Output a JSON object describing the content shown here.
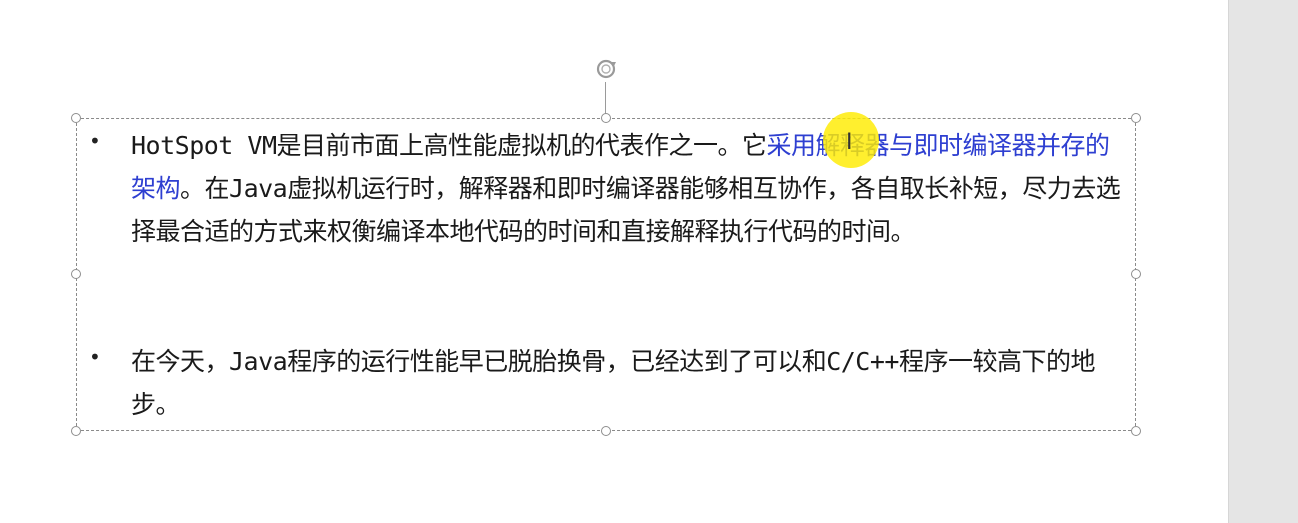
{
  "slide": {
    "bullets": [
      {
        "symbol": "•",
        "text_before": "HotSpot VM是目前市面上高性能虚拟机的代表作之一。它",
        "text_highlight": "采用解释器与即时编译器并存的架构",
        "text_after": "。在Java虚拟机运行时，解释器和即时编译器能够相互协作，各自取长补短，尽力去选择最合适的方式来权衡编译本地代码的时间和直接解释执行代码的时间。"
      },
      {
        "symbol": "•",
        "text": "在今天，Java程序的运行性能早已脱胎换骨，已经达到了可以和C/C++程序一较高下的地步。"
      }
    ]
  },
  "colors": {
    "highlight_text": "#2e3fd1",
    "cursor_highlight": "#ffeb00",
    "right_panel": "#e5e5e5"
  },
  "icons": {
    "rotate": "rotate-icon",
    "cursor": "ibeam-cursor-icon"
  }
}
